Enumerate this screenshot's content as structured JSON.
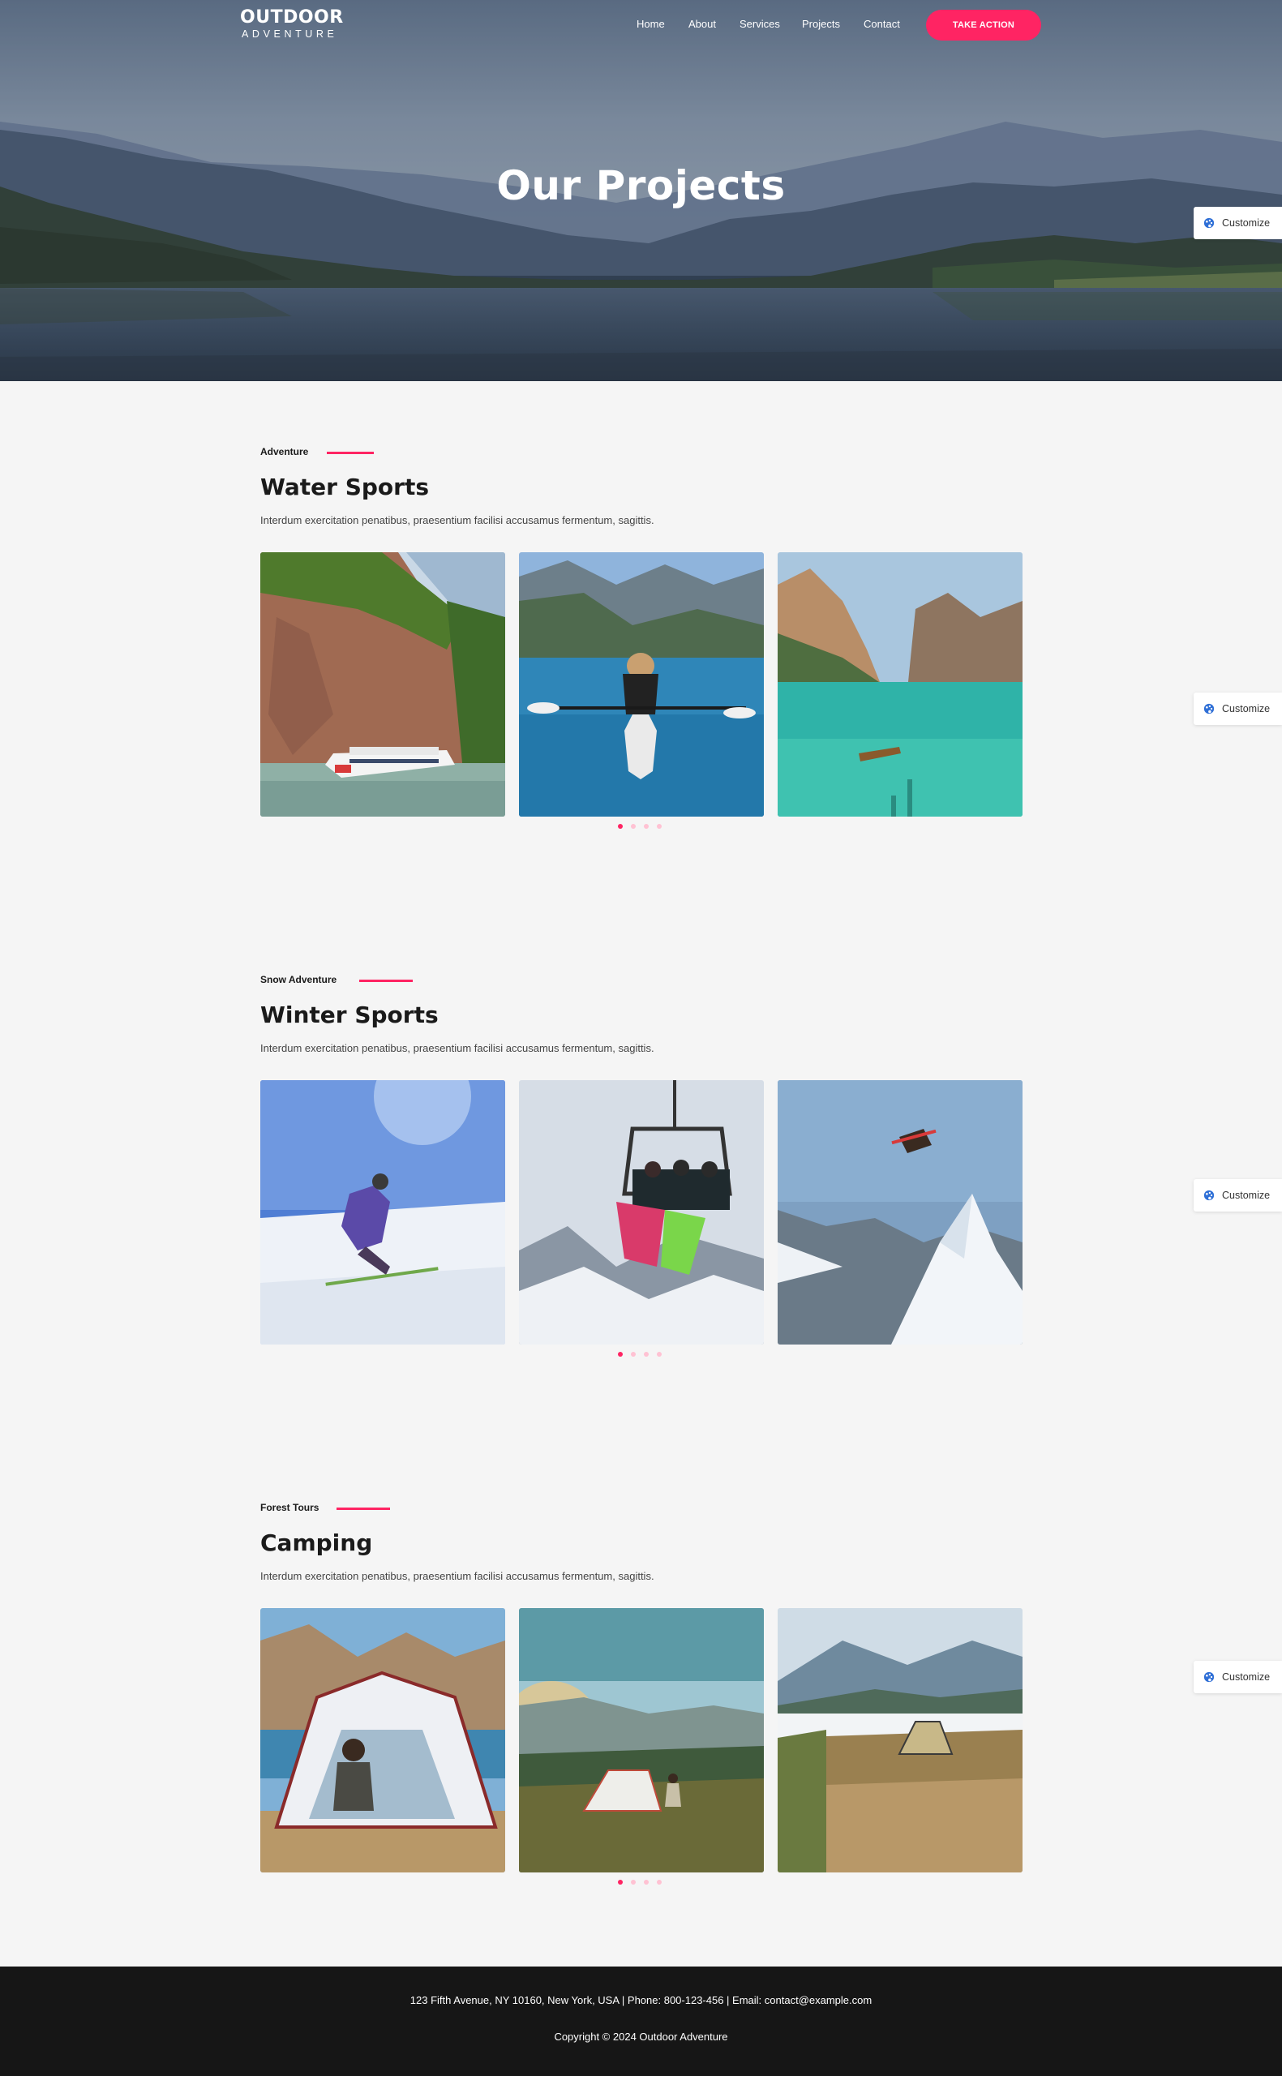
{
  "brand": {
    "name": "OUTDOOR",
    "tagline": "ADVENTURE"
  },
  "nav": {
    "items": [
      "Home",
      "About",
      "Services",
      "Projects",
      "Contact"
    ],
    "cta_label": "TAKE ACTION"
  },
  "hero": {
    "title": "Our Projects"
  },
  "customize": {
    "label": "Customize",
    "icon": "palette-icon"
  },
  "sections": [
    {
      "eyebrow": "Adventure",
      "title": "Water Sports",
      "description": "Interdum exercitation penatibus, praesentium facilisi accusamus fermentum, sagittis.",
      "slides_total": 4,
      "active_slide": 1
    },
    {
      "eyebrow": "Snow Adventure",
      "title": "Winter Sports",
      "description": "Interdum exercitation penatibus, praesentium facilisi accusamus fermentum, sagittis.",
      "slides_total": 4,
      "active_slide": 1
    },
    {
      "eyebrow": "Forest Tours",
      "title": "Camping",
      "description": "Interdum exercitation penatibus, praesentium facilisi accusamus fermentum, sagittis.",
      "slides_total": 4,
      "active_slide": 1
    }
  ],
  "footer": {
    "contact": "123 Fifth Avenue, NY 10160, New York, USA | Phone: 800-123-456 | Email: contact@example.com",
    "copyright": "Copyright © 2024 Outdoor Adventure"
  },
  "colors": {
    "accent": "#ff2463",
    "accent_light": "#ffc2d3",
    "footer_bg": "#161616",
    "page_bg": "#f5f5f5"
  }
}
